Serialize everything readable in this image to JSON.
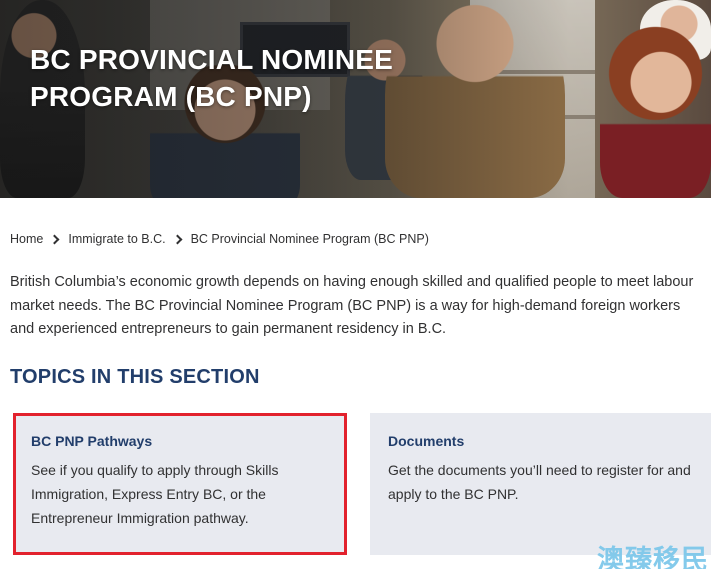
{
  "hero": {
    "title_line1": "BC PROVINCIAL NOMINEE",
    "title_line2": "PROGRAM (BC PNP)"
  },
  "breadcrumb": {
    "items": [
      "Home",
      "Immigrate to B.C.",
      "BC Provincial Nominee Program (BC PNP)"
    ]
  },
  "intro": {
    "text": "British Columbia’s economic growth depends on having enough skilled and qualified people to meet labour market needs. The BC Provincial Nominee Program (BC PNP) is a way for high-demand foreign workers and experienced entrepreneurs to gain permanent residency in B.C."
  },
  "topics": {
    "heading": "TOPICS IN THIS SECTION",
    "cards": [
      {
        "title": "BC PNP Pathways",
        "description": "See if you qualify to apply through Skills Immigration, Express Entry BC, or the Entrepreneur Immigration pathway."
      },
      {
        "title": "Documents",
        "description": "Get the documents you’ll need to register for and apply to the BC PNP."
      }
    ]
  },
  "watermark": "澳臻移民",
  "colors": {
    "heading_blue": "#223e6b",
    "card_bg": "#e8eaf0",
    "highlight_red": "#e2222d",
    "watermark_blue": "#7ec8ea"
  }
}
